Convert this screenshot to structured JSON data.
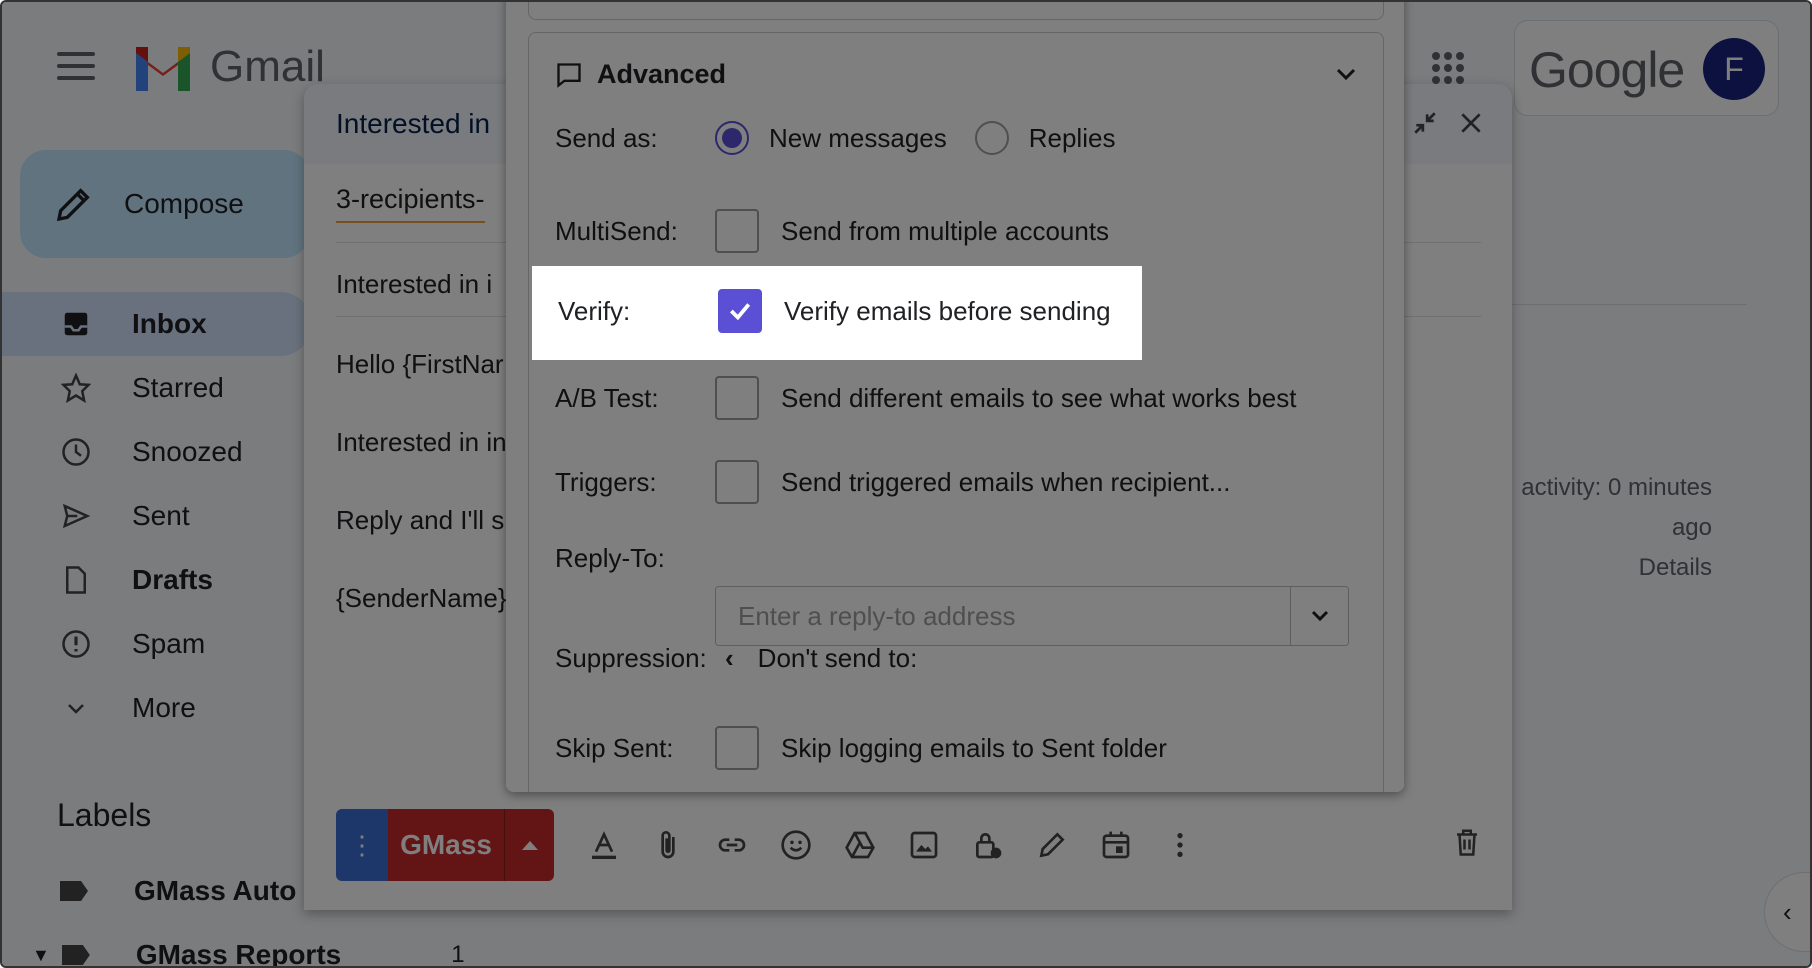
{
  "app": {
    "name": "Gmail",
    "brand": "Google",
    "avatar_letter": "F"
  },
  "compose_button": {
    "label": "Compose"
  },
  "nav": [
    {
      "label": "Inbox",
      "icon": "inbox-icon",
      "active": true
    },
    {
      "label": "Starred",
      "icon": "star-icon"
    },
    {
      "label": "Snoozed",
      "icon": "clock-icon"
    },
    {
      "label": "Sent",
      "icon": "send-icon"
    },
    {
      "label": "Drafts",
      "icon": "draft-icon",
      "bold": true
    },
    {
      "label": "Spam",
      "icon": "spam-icon"
    },
    {
      "label": "More",
      "icon": "chevron-down-icon"
    }
  ],
  "labels": {
    "title": "Labels",
    "items": [
      {
        "label": "GMass Auto"
      },
      {
        "label": "GMass Reports",
        "count": "1"
      }
    ]
  },
  "background_right": {
    "activity": "activity: 0 minutes",
    "ago": "ago",
    "details": "Details"
  },
  "compose": {
    "title": "Interested in",
    "to": "3-recipients-",
    "subject": "Interested in i",
    "body": [
      "Hello {FirstNar",
      "Interested in in",
      "Reply and I'll s",
      "{SenderName}"
    ],
    "gmass_label": "GMass"
  },
  "panel": {
    "section_title": "Advanced",
    "send_as": {
      "label": "Send as:",
      "option1": "New messages",
      "option2": "Replies",
      "selected": "New messages"
    },
    "multisend": {
      "label": "MultiSend:",
      "text": "Send from multiple accounts",
      "checked": false
    },
    "verify": {
      "label": "Verify:",
      "text": "Verify emails before sending",
      "checked": true
    },
    "ab_test": {
      "label": "A/B Test:",
      "text": "Send different emails to see what works best",
      "checked": false
    },
    "triggers": {
      "label": "Triggers:",
      "text": "Send triggered emails when recipient...",
      "checked": false
    },
    "reply_to": {
      "label": "Reply-To:",
      "placeholder": "Enter a reply-to address"
    },
    "suppression": {
      "label": "Suppression:",
      "text": "Don't send to:"
    },
    "skip_sent": {
      "label": "Skip Sent:",
      "text": "Skip logging emails to Sent folder",
      "checked": false
    }
  },
  "colors": {
    "accent": "#5b4fd6",
    "gmass_red": "#c62828",
    "blue_button": "#3b6fd4"
  }
}
